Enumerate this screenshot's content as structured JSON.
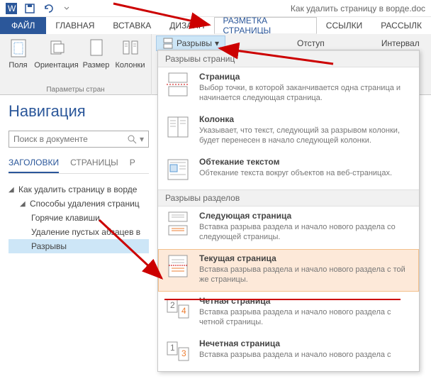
{
  "title": "Как удалить страницу в ворде.doc",
  "tabs": {
    "file": "ФАЙЛ",
    "home": "ГЛАВНАЯ",
    "insert": "ВСТАВКА",
    "design": "ДИЗАЙН",
    "layout": "РАЗМЕТКА СТРАНИЦЫ",
    "refs": "ССЫЛКИ",
    "mail": "РАССЫЛК"
  },
  "ribbon": {
    "margins": "Поля",
    "orientation": "Ориентация",
    "size": "Размер",
    "columns": "Колонки",
    "group_page": "Параметры стран",
    "breaks": "Разрывы",
    "indent": "Отступ",
    "spacing": "Интервал"
  },
  "menu": {
    "sec_page": "Разрывы страниц",
    "sec_section": "Разрывы разделов",
    "items": {
      "page": {
        "t": "Страница",
        "d": "Выбор точки, в которой заканчивается одна страница и начинается следующая страница."
      },
      "column": {
        "t": "Колонка",
        "d": "Указывает, что текст, следующий за разрывом колонки, будет перенесен в начало следующей колонки."
      },
      "wrap": {
        "t": "Обтекание текстом",
        "d": "Обтекание текста вокруг объектов на веб-страницах."
      },
      "next": {
        "t": "Следующая страница",
        "d": "Вставка разрыва раздела и начало нового раздела со следующей страницы."
      },
      "cont": {
        "t": "Текущая страница",
        "d": "Вставка разрыва раздела и начало нового раздела с той же страницы."
      },
      "even": {
        "t": "Четная страница",
        "d": "Вставка разрыва раздела и начало нового раздела с четной страницы."
      },
      "odd": {
        "t": "Нечетная страница",
        "d": "Вставка разрыва раздела и начало нового раздела с"
      }
    }
  },
  "nav": {
    "title": "Навигация",
    "search_ph": "Поиск в документе",
    "tabs": {
      "headings": "ЗАГОЛОВКИ",
      "pages": "СТРАНИЦЫ",
      "results": "Р"
    },
    "tree": {
      "root": "Как удалить страницу в ворде",
      "node": "Способы удаления страниц",
      "leaf1": "Горячие клавиши",
      "leaf2": "Удаление пустых абзацев в",
      "leaf3": "Разрывы"
    }
  }
}
